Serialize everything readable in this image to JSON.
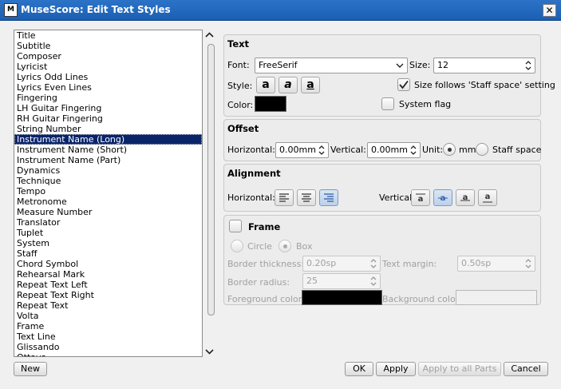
{
  "window": {
    "title": "MuseScore: Edit Text Styles",
    "close_glyph": "✕",
    "app_icon": "ms-icon"
  },
  "styles_list": {
    "selected_index": 10,
    "items": [
      "Title",
      "Subtitle",
      "Composer",
      "Lyricist",
      "Lyrics Odd Lines",
      "Lyrics Even Lines",
      "Fingering",
      "LH Guitar Fingering",
      "RH Guitar Fingering",
      "String Number",
      "Instrument Name (Long)",
      "Instrument Name (Short)",
      "Instrument Name (Part)",
      "Dynamics",
      "Technique",
      "Tempo",
      "Metronome",
      "Measure Number",
      "Translator",
      "Tuplet",
      "System",
      "Staff",
      "Chord Symbol",
      "Rehearsal Mark",
      "Repeat Text Left",
      "Repeat Text Right",
      "Repeat Text",
      "Volta",
      "Frame",
      "Text Line",
      "Glissando",
      "Ottava"
    ]
  },
  "text_group": {
    "title": "Text",
    "font_label": "Font:",
    "font_value": "FreeSerif",
    "size_label": "Size:",
    "size_value": "12",
    "style_label": "Style:",
    "bold_glyph": "a",
    "italic_glyph": "a",
    "underline_glyph": "a",
    "size_follows_label": "Size follows 'Staff space' setting",
    "size_follows_checked": true,
    "color_label": "Color:",
    "color_value": "#000000",
    "system_flag_label": "System flag",
    "system_flag_checked": false
  },
  "offset_group": {
    "title": "Offset",
    "horizontal_label": "Horizontal:",
    "horizontal_value": "0.00mm",
    "vertical_label": "Vertical:",
    "vertical_value": "0.00mm",
    "unit_label": "Unit:",
    "unit_mm_label": "mm",
    "unit_staff_label": "Staff space",
    "unit_selected": "mm"
  },
  "alignment_group": {
    "title": "Alignment",
    "horizontal_label": "Horizontal:",
    "horizontal_selected": "right",
    "vertical_label": "Vertical:",
    "vertical_selected": "center",
    "vertical_glyph": "a"
  },
  "frame_group": {
    "title": "Frame",
    "frame_checked": false,
    "circle_label": "Circle",
    "box_label": "Box",
    "box_selected": true,
    "border_thickness_label": "Border thickness:",
    "border_thickness_value": "0.20sp",
    "text_margin_label": "Text margin:",
    "text_margin_value": "0.50sp",
    "border_radius_label": "Border radius:",
    "border_radius_value": "25",
    "foreground_color_label": "Foreground color:",
    "foreground_color": "#000000",
    "background_color_label": "Background color:"
  },
  "buttons": {
    "new": "New",
    "ok": "OK",
    "apply": "Apply",
    "apply_all_parts": "Apply to all Parts",
    "cancel": "Cancel"
  },
  "scroll": {
    "up_glyph": "▲",
    "down_glyph": "▼"
  }
}
